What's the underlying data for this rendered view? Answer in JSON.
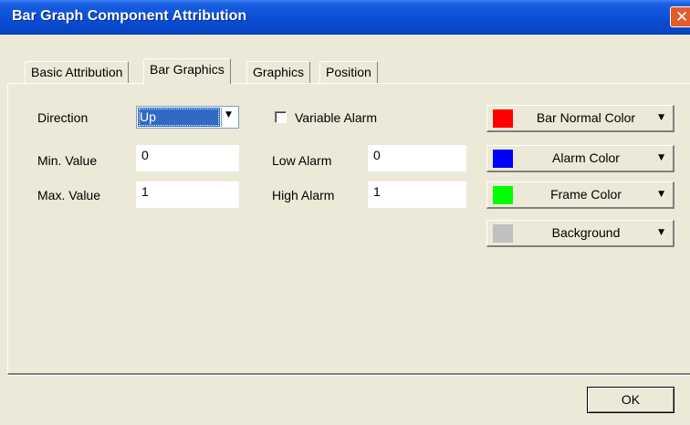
{
  "window": {
    "title": "Bar Graph Component Attribution"
  },
  "tabs": [
    {
      "label": "Basic Attribution",
      "active": false
    },
    {
      "label": "Bar Graphics",
      "active": true
    },
    {
      "label": "Graphics",
      "active": false
    },
    {
      "label": "Position",
      "active": false
    }
  ],
  "form": {
    "direction": {
      "label": "Direction",
      "value": "Up"
    },
    "min_value": {
      "label": "Min. Value",
      "value": "0"
    },
    "max_value": {
      "label": "Max. Value",
      "value": "1"
    },
    "variable_alarm": {
      "label": "Variable Alarm",
      "checked": false
    },
    "low_alarm": {
      "label": "Low Alarm",
      "value": "0"
    },
    "high_alarm": {
      "label": "High Alarm",
      "value": "1"
    }
  },
  "colors": [
    {
      "label": "Bar Normal Color",
      "swatch": "#ff0000"
    },
    {
      "label": "Alarm Color",
      "swatch": "#0000ff"
    },
    {
      "label": "Frame Color",
      "swatch": "#00ff00"
    },
    {
      "label": "Background",
      "swatch": "#c0c0c0"
    }
  ],
  "footer": {
    "ok_label": "OK"
  },
  "icons": {
    "close": "close-icon",
    "dropdown": "chevron-down-icon"
  },
  "theme": {
    "titlebar": "#0a4fd8",
    "dialog_bg": "#ece9d8",
    "selection": "#316ac5"
  }
}
